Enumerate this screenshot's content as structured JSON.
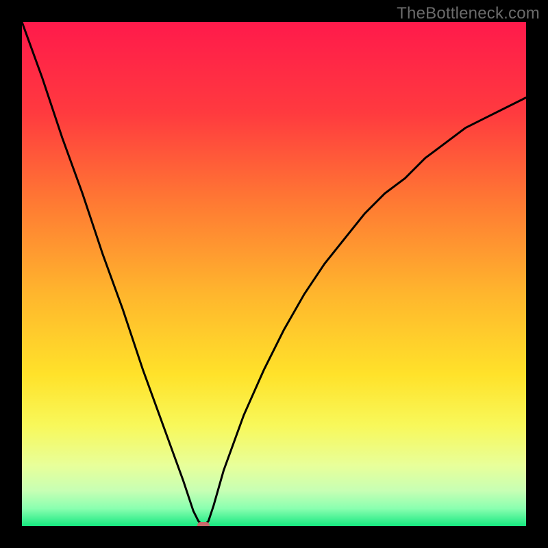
{
  "watermark": "TheBottleneck.com",
  "chart_data": {
    "type": "line",
    "title": "",
    "xlabel": "",
    "ylabel": "",
    "xlim": [
      0,
      100
    ],
    "ylim": [
      0,
      100
    ],
    "grid": false,
    "legend": false,
    "series": [
      {
        "name": "bottleneck-curve",
        "x": [
          0,
          4,
          8,
          12,
          16,
          20,
          24,
          28,
          32,
          34,
          35,
          36,
          37,
          38,
          40,
          44,
          48,
          52,
          56,
          60,
          64,
          68,
          72,
          76,
          80,
          84,
          88,
          92,
          96,
          100
        ],
        "values": [
          100,
          89,
          77,
          66,
          54,
          43,
          31,
          20,
          9,
          3,
          1,
          0,
          1,
          4,
          11,
          22,
          31,
          39,
          46,
          52,
          57,
          62,
          66,
          69,
          73,
          76,
          79,
          81,
          83,
          85
        ]
      }
    ],
    "marker": {
      "x": 36,
      "y": 0,
      "color": "#c76a6a"
    },
    "gradient_stops": [
      {
        "offset": 0.0,
        "color": "#ff1a4b"
      },
      {
        "offset": 0.18,
        "color": "#ff3a3f"
      },
      {
        "offset": 0.36,
        "color": "#ff7a33"
      },
      {
        "offset": 0.54,
        "color": "#ffb62d"
      },
      {
        "offset": 0.7,
        "color": "#ffe22a"
      },
      {
        "offset": 0.8,
        "color": "#f8f85a"
      },
      {
        "offset": 0.88,
        "color": "#e8ff9a"
      },
      {
        "offset": 0.93,
        "color": "#c7ffb4"
      },
      {
        "offset": 0.965,
        "color": "#8affb0"
      },
      {
        "offset": 1.0,
        "color": "#17e880"
      }
    ]
  }
}
